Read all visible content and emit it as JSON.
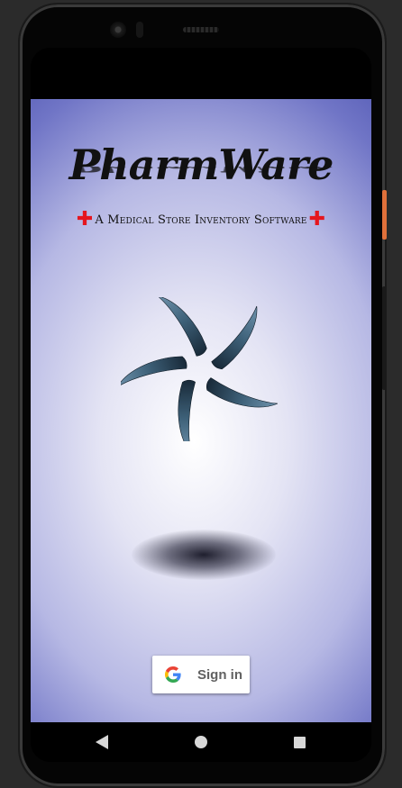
{
  "app": {
    "title": "PharmWare",
    "subtitle": "A Medical Store Inventory Software",
    "cross_symbol": "✚",
    "accent_red": "#e5161e",
    "background_color": "#7075c6"
  },
  "signin_button": {
    "label": "Sign in",
    "icon": "google-g-icon"
  },
  "navigation": {
    "back_icon": "back-triangle-icon",
    "home_icon": "home-circle-icon",
    "recents_icon": "recents-square-icon"
  }
}
